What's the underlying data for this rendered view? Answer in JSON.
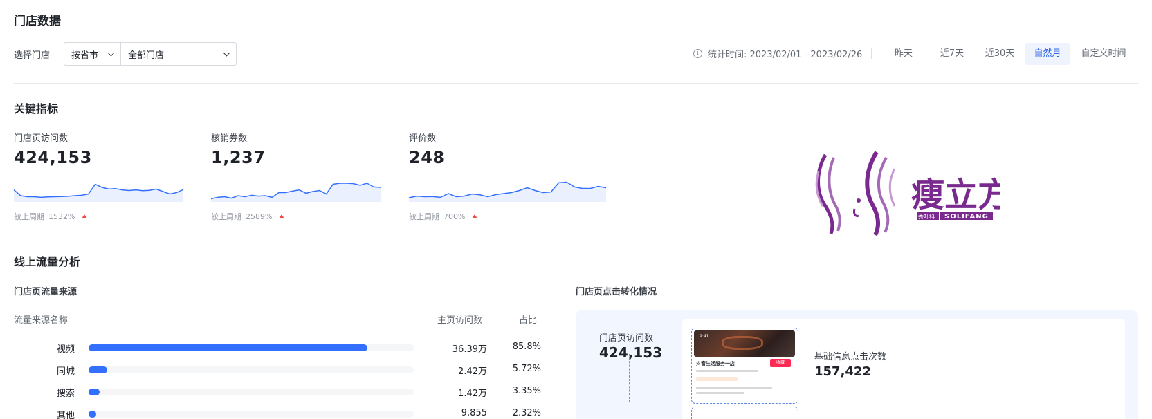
{
  "page_title": "门店数据",
  "filters": {
    "label": "选择门店",
    "region_select": "按省市",
    "store_select": "全部门店"
  },
  "stat_time": {
    "icon": "info-icon",
    "text": "统计时间: 2023/02/01 - 2023/02/26"
  },
  "date_ranges": [
    {
      "label": "昨天",
      "active": false
    },
    {
      "label": "近7天",
      "active": false
    },
    {
      "label": "近30天",
      "active": false
    },
    {
      "label": "自然月",
      "active": true
    },
    {
      "label": "自定义时间",
      "active": false
    }
  ],
  "key_metrics": {
    "title": "关键指标",
    "items": [
      {
        "label": "门店页访问数",
        "value": "424,153",
        "compare_label": "较上周期",
        "compare_value": "1532%",
        "trend": "up",
        "sparkline": [
          0.42,
          0.7,
          0.75,
          0.75,
          0.78,
          0.76,
          0.75,
          0.74,
          0.73,
          0.7,
          0.68,
          0.62,
          0.15,
          0.3,
          0.38,
          0.36,
          0.42,
          0.45,
          0.42,
          0.46,
          0.44,
          0.38,
          0.5,
          0.62,
          0.55,
          0.4
        ]
      },
      {
        "label": "核销券数",
        "value": "1,237",
        "compare_label": "较上周期",
        "compare_value": "2589%",
        "trend": "up",
        "sparkline": [
          0.85,
          0.78,
          0.75,
          0.82,
          0.7,
          0.75,
          0.68,
          0.72,
          0.7,
          0.78,
          0.55,
          0.55,
          0.48,
          0.42,
          0.58,
          0.5,
          0.45,
          0.62,
          0.15,
          0.1,
          0.1,
          0.12,
          0.2,
          0.1,
          0.28,
          0.3
        ]
      },
      {
        "label": "评价数",
        "value": "248",
        "compare_label": "较上周期",
        "compare_value": "700%",
        "trend": "up",
        "sparkline": [
          0.8,
          0.72,
          0.75,
          0.74,
          0.78,
          0.6,
          0.75,
          0.72,
          0.62,
          0.66,
          0.75,
          0.65,
          0.6,
          0.55,
          0.45,
          0.32,
          0.45,
          0.55,
          0.52,
          0.08,
          0.05,
          0.28,
          0.35,
          0.35,
          0.25,
          0.32
        ]
      }
    ]
  },
  "logo": {
    "brand_cn": "瘦立方",
    "brand_en": "SOLIFANG",
    "tag": "秀叶科"
  },
  "online_traffic": {
    "title": "线上流量分析",
    "sources": {
      "title": "门店页流量来源",
      "columns": [
        "流量来源名称",
        "主页访问数",
        "占比"
      ],
      "rows": [
        {
          "name": "视频",
          "visits": "36.39万",
          "ratio": "85.8%",
          "share": 0.858
        },
        {
          "name": "同城",
          "visits": "2.42万",
          "ratio": "5.72%",
          "share": 0.0572
        },
        {
          "name": "搜索",
          "visits": "1.42万",
          "ratio": "3.35%",
          "share": 0.0335
        },
        {
          "name": "其他",
          "visits": "9,855",
          "ratio": "2.32%",
          "share": 0.0232
        }
      ]
    },
    "conversion": {
      "title": "门店页点击转化情况",
      "visits_label": "门店页访问数",
      "visits_value": "424,153",
      "basic_info_label": "基础信息点击次数",
      "basic_info_value": "157,422",
      "preview": {
        "time": "9:41",
        "store_name": "抖音生活服务一店",
        "button": "收藏"
      }
    }
  }
}
